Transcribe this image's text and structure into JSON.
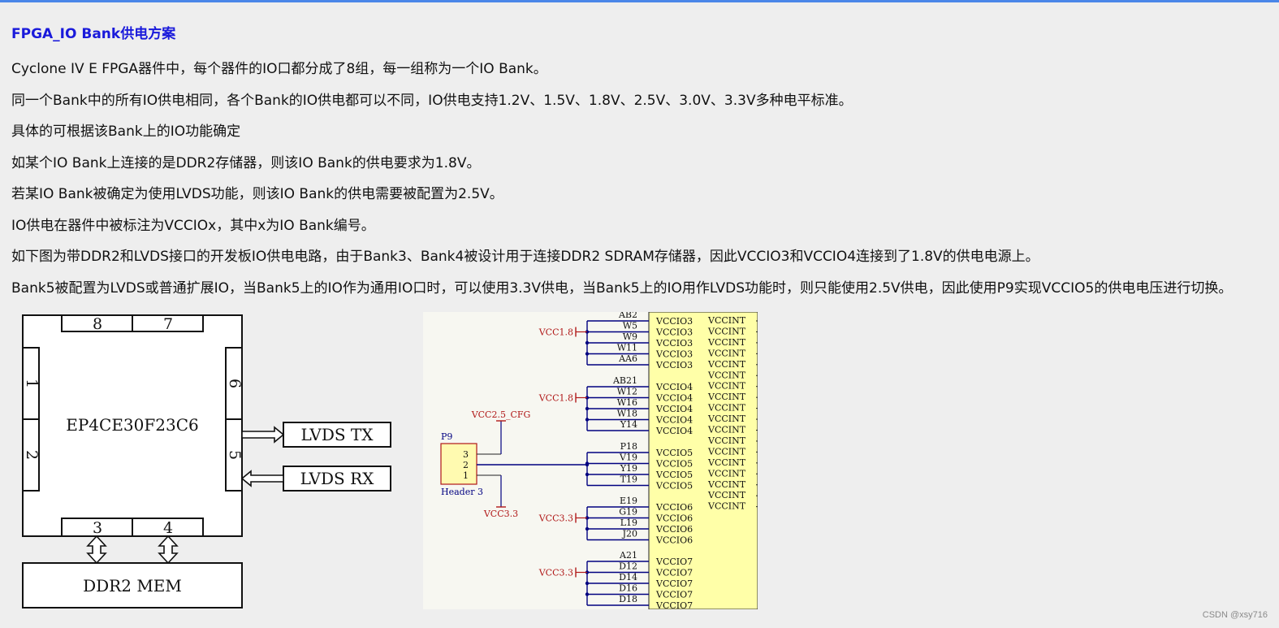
{
  "article": {
    "title": "FPGA_IO Bank供电方案",
    "paragraphs": [
      "Cyclone IV E FPGA器件中，每个器件的IO口都分成了8组，每一组称为一个IO Bank。",
      "同一个Bank中的所有IO供电相同，各个Bank的IO供电都可以不同，IO供电支持1.2V、1.5V、1.8V、2.5V、3.0V、3.3V多种电平标准。",
      "具体的可根据该Bank上的IO功能确定",
      "如某个IO Bank上连接的是DDR2存储器，则该IO Bank的供电要求为1.8V。",
      "若某IO Bank被确定为使用LVDS功能，则该IO Bank的供电需要被配置为2.5V。",
      "IO供电在器件中被标注为VCCIOx，其中x为IO Bank编号。",
      "如下图为带DDR2和LVDS接口的开发板IO供电电路，由于Bank3、Bank4被设计用于连接DDR2 SDRAM存储器，因此VCCIO3和VCCIO4连接到了1.8V的供电电源上。",
      "Bank5被配置为LVDS或普通扩展IO，当Bank5上的IO作为通用IO口时，可以使用3.3V供电，当Bank5上的IO用作LVDS功能时，则只能使用2.5V供电，因此使用P9实现VCCIO5的供电电压进行切换。"
    ]
  },
  "block_diagram": {
    "chip_label": "EP4CE30F23C6",
    "banks": {
      "top_left": "8",
      "top_right": "7",
      "left_top": "1",
      "left_bottom": "2",
      "right_top": "6",
      "right_bottom": "5",
      "bottom_left": "3",
      "bottom_right": "4"
    },
    "lvds_tx": "LVDS TX",
    "lvds_rx": "LVDS RX",
    "ddr2_mem": "DDR2 MEM"
  },
  "schematic": {
    "colors": {
      "background": "#f7f7f1",
      "chip_fill": "#ffffa8",
      "wire": "#000080",
      "power": "#b01818"
    },
    "groups": [
      {
        "power": "VCC1.8",
        "pins": [
          "AB2",
          "W5",
          "W9",
          "W11",
          "AA6"
        ],
        "nets": [
          "VCCIO3",
          "VCCIO3",
          "VCCIO3",
          "VCCIO3",
          "VCCIO3"
        ]
      },
      {
        "power": "VCC1.8",
        "pins": [
          "AB21",
          "W12",
          "W16",
          "W18",
          "Y14"
        ],
        "nets": [
          "VCCIO4",
          "VCCIO4",
          "VCCIO4",
          "VCCIO4",
          "VCCIO4"
        ]
      },
      {
        "power": "",
        "pins": [
          "P18",
          "V19",
          "Y19",
          "T19"
        ],
        "nets": [
          "VCCIO5",
          "VCCIO5",
          "VCCIO5",
          "VCCIO5"
        ]
      },
      {
        "power": "VCC3.3",
        "pins": [
          "E19",
          "G19",
          "L19",
          "J20"
        ],
        "nets": [
          "VCCIO6",
          "VCCIO6",
          "VCCIO6",
          "VCCIO6"
        ]
      },
      {
        "power": "VCC3.3",
        "pins": [
          "A21",
          "D12",
          "D14",
          "D16",
          "D18"
        ],
        "nets": [
          "VCCIO7",
          "VCCIO7",
          "VCCIO7",
          "VCCIO7",
          "VCCIO7"
        ]
      }
    ],
    "vccint": [
      "VCCINT",
      "VCCINT",
      "VCCINT",
      "VCCINT",
      "VCCINT",
      "VCCINT",
      "VCCINT",
      "VCCINT",
      "VCCINT",
      "VCCINT",
      "VCCINT",
      "VCCINT",
      "VCCINT",
      "VCCINT",
      "VCCINT",
      "VCCINT",
      "VCCINT",
      "VCCINT"
    ],
    "header": {
      "designator": "P9",
      "pins": [
        "3",
        "2",
        "1"
      ],
      "name": "Header 3",
      "vcc_top": "VCC2.5_CFG",
      "vcc_bottom": "VCC3.3"
    }
  },
  "watermark": "CSDN @xsy716"
}
